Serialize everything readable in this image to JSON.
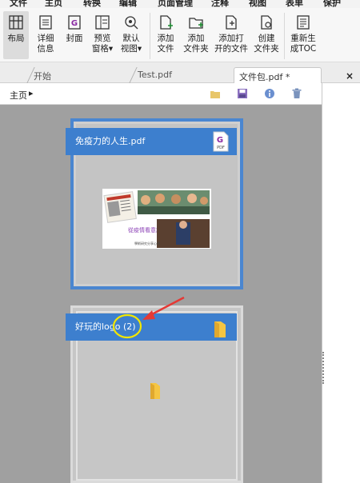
{
  "menu": [
    "文件",
    "主页",
    "转换",
    "编辑",
    "页面管理",
    "注释",
    "视图",
    "表单",
    "保护"
  ],
  "ribbon": {
    "layout": "布局",
    "details": [
      "详细",
      "信息"
    ],
    "cover": "封面",
    "preview_pane": [
      "预览",
      "窗格▾"
    ],
    "default_view": [
      "默认",
      "视图▾"
    ],
    "add_file": [
      "添加",
      "文件"
    ],
    "add_folder": [
      "添加",
      "文件夹"
    ],
    "add_open_files": [
      "添加打",
      "开的文件"
    ],
    "create_folder": [
      "创建",
      "文件夹"
    ],
    "regen_toc": [
      "重新生",
      "成TOC"
    ]
  },
  "tabs": [
    "开始",
    "Test.pdf",
    "文件包.pdf *"
  ],
  "close_symbol": "×",
  "toolbar": {
    "home": "主页",
    "arrow": "▸"
  },
  "cards": {
    "pdf_name": "免疫力的人生.pdf",
    "pdf_badge": "PDF",
    "folder_name": "好玩的logo",
    "folder_count": "(2)"
  },
  "thumbnail": {
    "subtitle": "從疫情看意識",
    "footer": "學術研究分享心得"
  },
  "colors": {
    "accent": "#3d7fce",
    "annotation_arrow": "#e53935",
    "annotation_circle": "#f2e600",
    "folder": "#f5c542"
  }
}
